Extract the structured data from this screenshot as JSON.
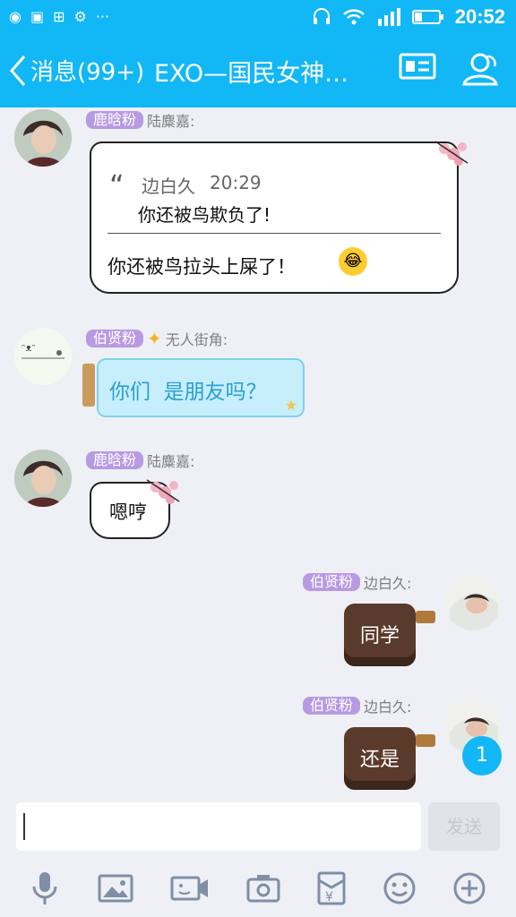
{
  "status_bar": {
    "time": "20:52",
    "more": "···"
  },
  "header": {
    "back_label": "消息(99+)",
    "title": "EXO—国民女神…"
  },
  "messages": [
    {
      "badge": "鹿晗粉",
      "sender": "陆麋嘉:",
      "quote_author": "边白久",
      "quote_time": "20:29",
      "quote_text": "你还被鸟欺负了!",
      "text": "你还被鸟拉头上屎了！"
    },
    {
      "badge": "伯贤粉",
      "sender": "无人街角:",
      "text": "你们  是朋友吗？"
    },
    {
      "badge": "鹿晗粉",
      "sender": "陆麋嘉:",
      "text": "嗯哼"
    },
    {
      "badge": "伯贤粉",
      "sender": "边白久:",
      "text": "同学"
    },
    {
      "badge": "伯贤粉",
      "sender": "边白久:",
      "text": "还是"
    }
  ],
  "input": {
    "send_label": "发送"
  },
  "unread_count": "1"
}
